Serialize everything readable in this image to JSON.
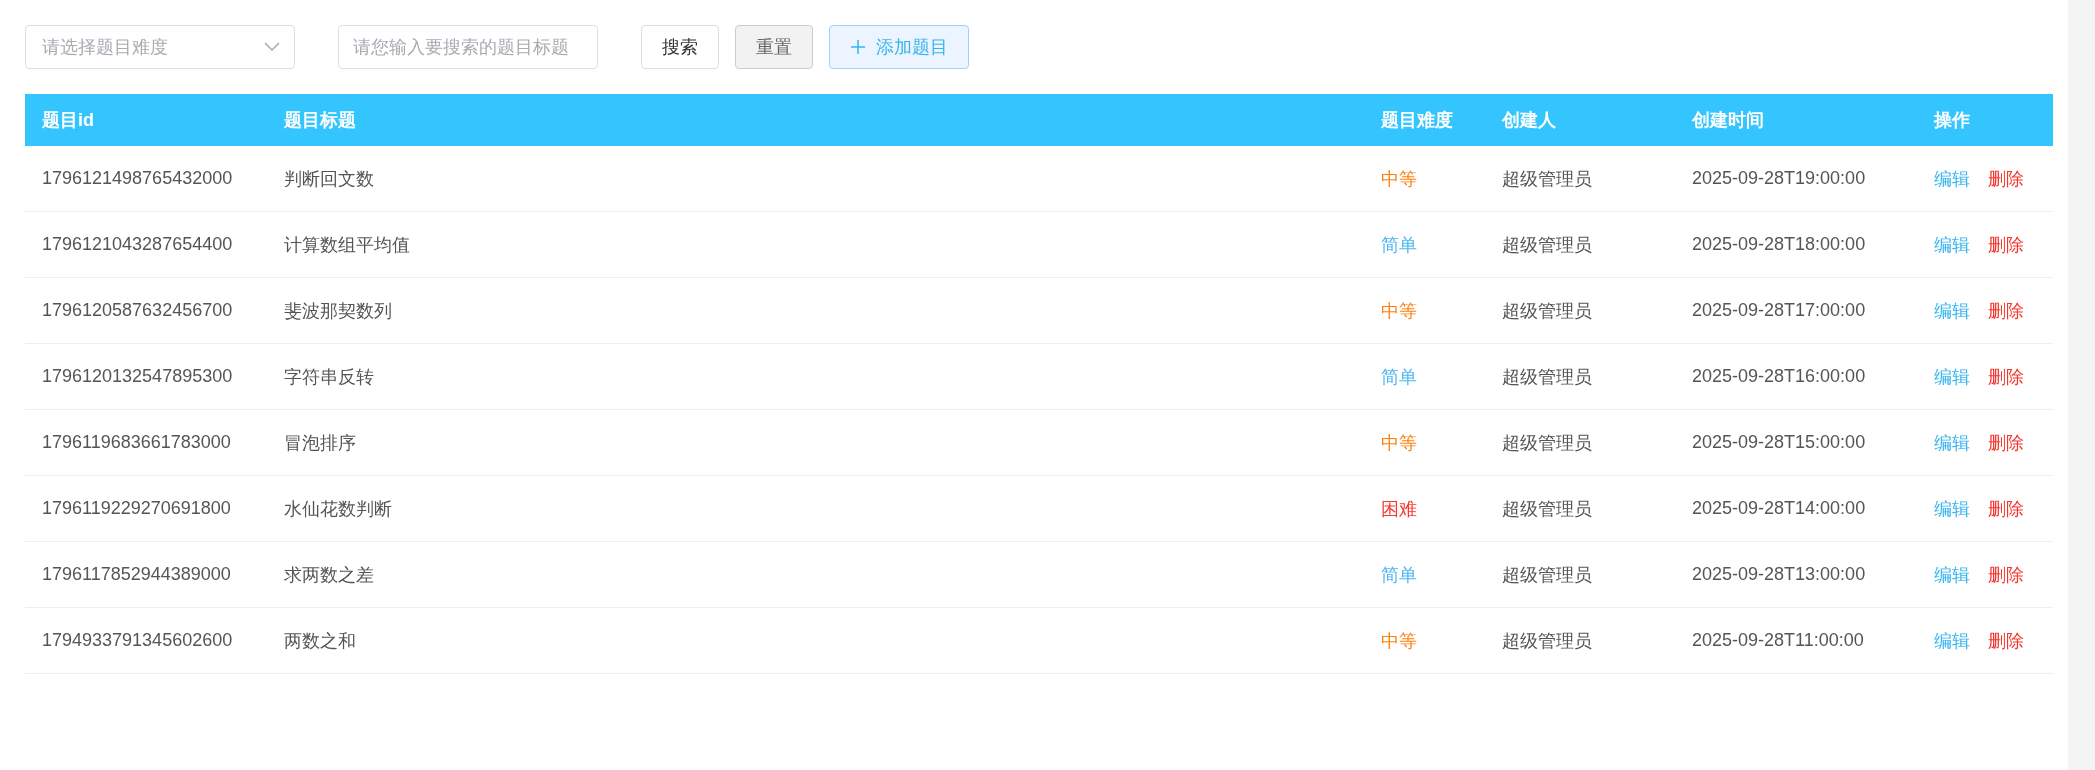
{
  "toolbar": {
    "difficulty_select": {
      "placeholder": "请选择题目难度"
    },
    "title_search": {
      "placeholder": "请您输入要搜索的题目标题"
    },
    "buttons": [
      {
        "label": "搜索",
        "kind": "default"
      },
      {
        "label": "重置",
        "kind": "muted"
      },
      {
        "label": "添加题目",
        "kind": "add"
      }
    ]
  },
  "table": {
    "columns": [
      "题目id",
      "题目标题",
      "题目难度",
      "创建人",
      "创建时间",
      "操作"
    ],
    "rows": [
      {
        "id": "1796121498765432000",
        "title": "判断回文数",
        "difficulty": "中等",
        "color": "#ff7f0e",
        "creator": "超级管理员",
        "created": "2025-09-28T19:00:00",
        "actions": [
          "编辑",
          "删除"
        ]
      },
      {
        "id": "1796121043287654400",
        "title": "计算数组平均值",
        "difficulty": "简单",
        "color": "#4fb6f0",
        "creator": "超级管理员",
        "created": "2025-09-28T18:00:00",
        "actions": [
          "编辑",
          "删除"
        ]
      },
      {
        "id": "1796120587632456700",
        "title": "斐波那契数列",
        "difficulty": "中等",
        "color": "#ff7f0e",
        "creator": "超级管理员",
        "created": "2025-09-28T17:00:00",
        "actions": [
          "编辑",
          "删除"
        ]
      },
      {
        "id": "1796120132547895300",
        "title": "字符串反转",
        "difficulty": "简单",
        "color": "#4fb6f0",
        "creator": "超级管理员",
        "created": "2025-09-28T16:00:00",
        "actions": [
          "编辑",
          "删除"
        ]
      },
      {
        "id": "1796119683661783000",
        "title": "冒泡排序",
        "difficulty": "中等",
        "color": "#ff7f0e",
        "creator": "超级管理员",
        "created": "2025-09-28T15:00:00",
        "actions": [
          "编辑",
          "删除"
        ]
      },
      {
        "id": "1796119229270691800",
        "title": "水仙花数判断",
        "difficulty": "困难",
        "color": "#f5362f",
        "creator": "超级管理员",
        "created": "2025-09-28T14:00:00",
        "actions": [
          "编辑",
          "删除"
        ]
      },
      {
        "id": "1796117852944389000",
        "title": "求两数之差",
        "difficulty": "简单",
        "color": "#4fb6f0",
        "creator": "超级管理员",
        "created": "2025-09-28T13:00:00",
        "actions": [
          "编辑",
          "删除"
        ]
      },
      {
        "id": "1794933791345602600",
        "title": "两数之和",
        "difficulty": "中等",
        "color": "#ff7f0e",
        "creator": "超级管理员",
        "created": "2025-09-28T11:00:00",
        "actions": [
          "编辑",
          "删除"
        ]
      }
    ]
  }
}
